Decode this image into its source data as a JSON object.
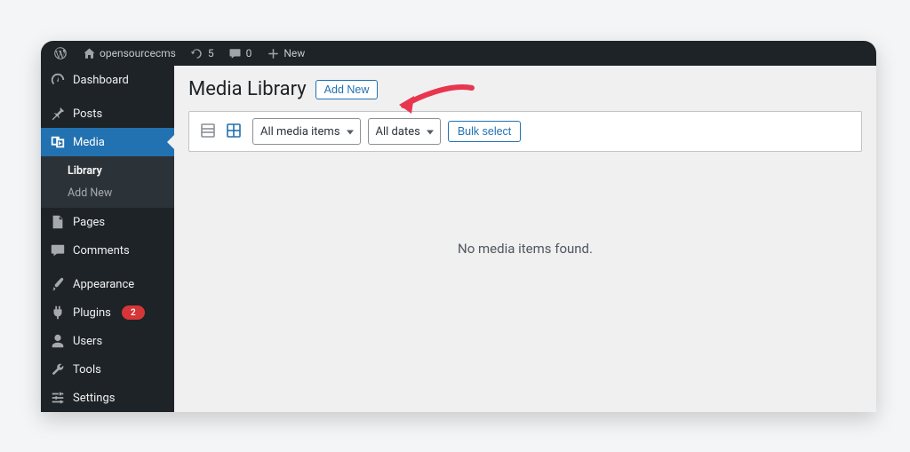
{
  "adminbar": {
    "site_name": "opensourcecms",
    "updates_count": "5",
    "comments_count": "0",
    "new_label": "New"
  },
  "sidebar": {
    "dashboard": "Dashboard",
    "posts": "Posts",
    "media": "Media",
    "media_sub": {
      "library": "Library",
      "addnew": "Add New"
    },
    "pages": "Pages",
    "comments": "Comments",
    "appearance": "Appearance",
    "plugins": "Plugins",
    "plugins_badge": "2",
    "users": "Users",
    "tools": "Tools",
    "settings": "Settings"
  },
  "main": {
    "title": "Media Library",
    "addnew_btn": "Add New",
    "filter_media_items": "All media items",
    "filter_dates": "All dates",
    "bulk_select": "Bulk select",
    "empty": "No media items found."
  },
  "colors": {
    "accent": "#2271b1",
    "danger": "#d63638"
  }
}
